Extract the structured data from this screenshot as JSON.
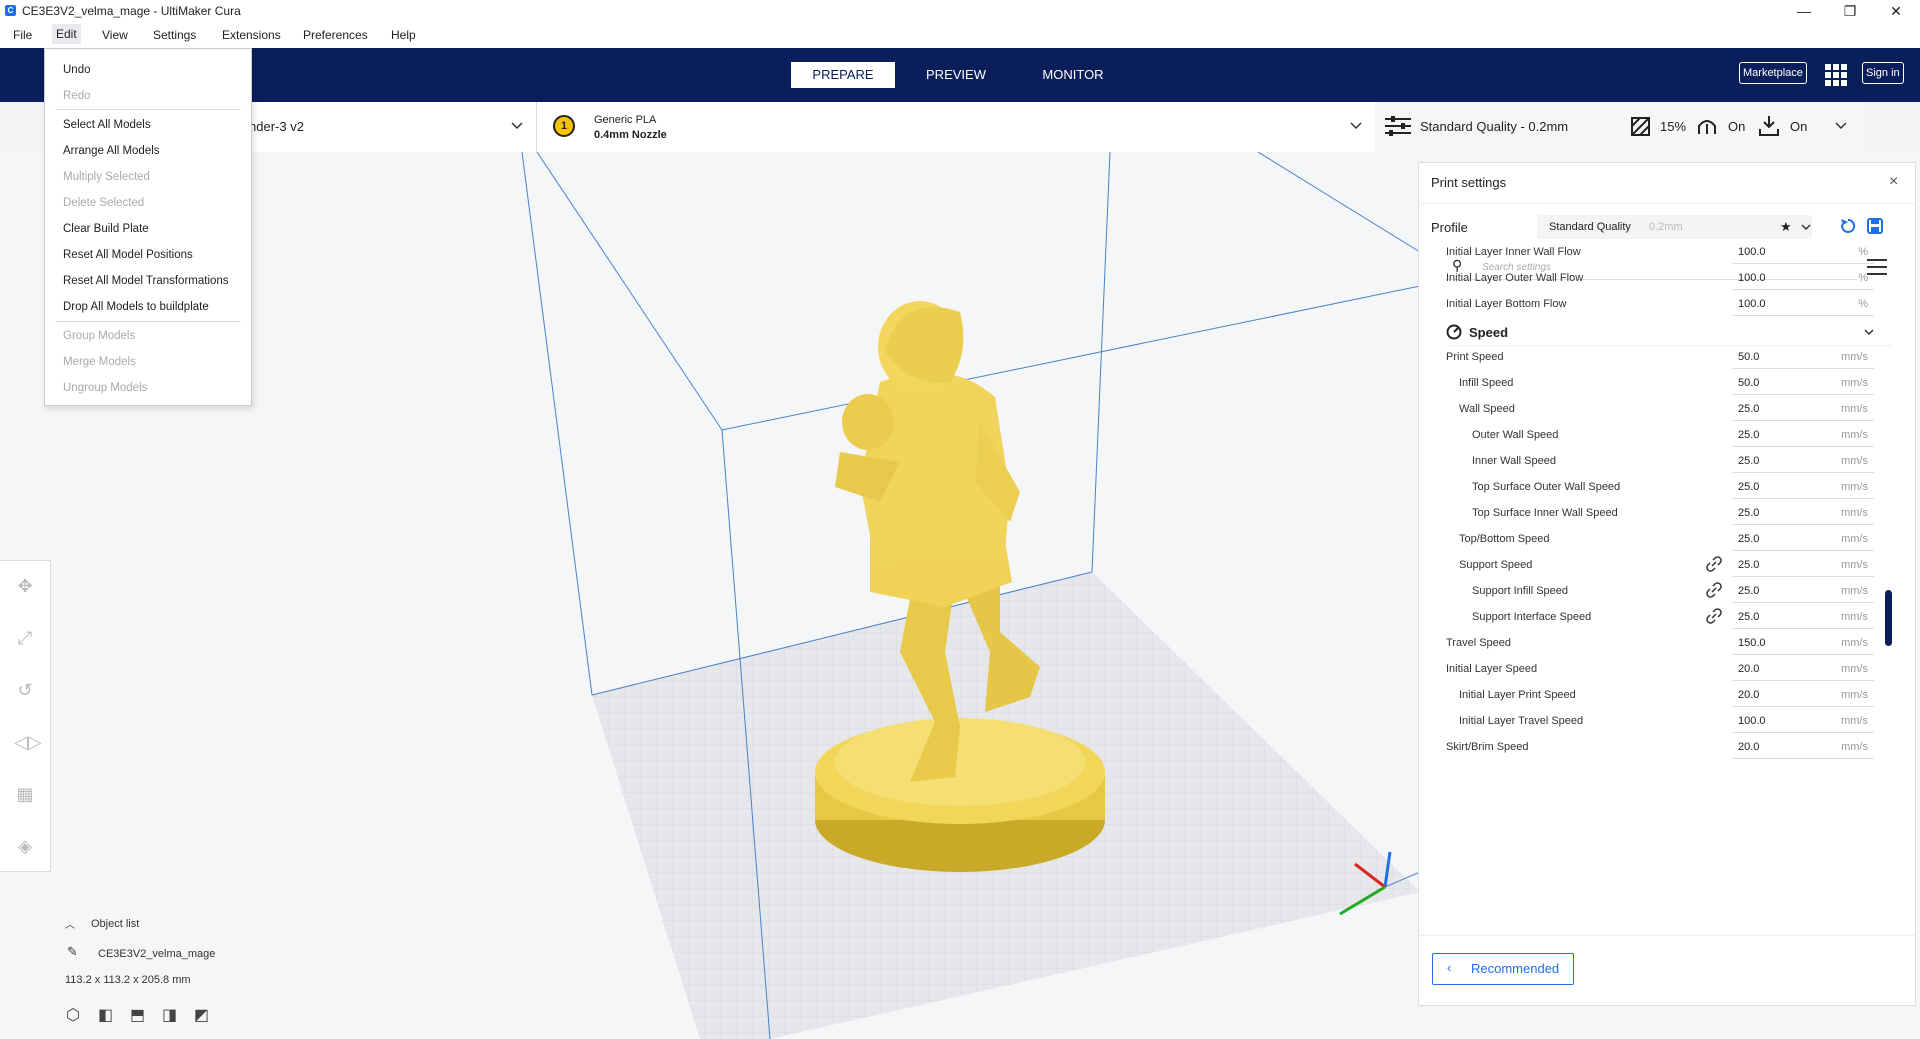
{
  "window": {
    "title": "CE3E3V2_velma_mage - UltiMaker Cura",
    "app_icon": "cura-icon",
    "controls": [
      "minimize-icon",
      "restore-icon",
      "close-icon"
    ]
  },
  "menubar": {
    "items": [
      {
        "label": "File"
      },
      {
        "label": "Edit"
      },
      {
        "label": "View"
      },
      {
        "label": "Settings"
      },
      {
        "label": "Extensions"
      },
      {
        "label": "Preferences"
      },
      {
        "label": "Help"
      }
    ]
  },
  "edit_menu": {
    "items": [
      {
        "label": "Undo",
        "enabled": true
      },
      {
        "label": "Redo",
        "enabled": false
      },
      {
        "label": "Select All Models",
        "enabled": true
      },
      {
        "label": "Arrange All Models",
        "enabled": true
      },
      {
        "label": "Multiply Selected",
        "enabled": false
      },
      {
        "label": "Delete Selected",
        "enabled": false
      },
      {
        "label": "Clear Build Plate",
        "enabled": true
      },
      {
        "label": "Reset All Model Positions",
        "enabled": true
      },
      {
        "label": "Reset All Model Transformations",
        "enabled": true
      },
      {
        "label": "Drop All Models to buildplate",
        "enabled": true
      },
      {
        "label": "Group Models",
        "enabled": false
      },
      {
        "label": "Merge Models",
        "enabled": false
      },
      {
        "label": "Ungroup Models",
        "enabled": false
      }
    ]
  },
  "header": {
    "tabs": [
      {
        "label": "PREPARE",
        "active": true
      },
      {
        "label": "PREVIEW",
        "active": false
      },
      {
        "label": "MONITOR",
        "active": false
      }
    ],
    "marketplace_label": "Marketplace",
    "signin_label": "Sign in"
  },
  "printer_bar": {
    "printer_name_partial": "nder-3 v2",
    "extruder_number": "1",
    "material": "Generic PLA",
    "nozzle": "0.4mm Nozzle",
    "quality": "Standard Quality - 0.2mm",
    "infill": "15%",
    "support": "On",
    "adhesion": "On"
  },
  "print_settings": {
    "title": "Print settings",
    "profile_label": "Profile",
    "profile_value": "Standard Quality",
    "profile_suffix": "0.2mm",
    "search_placeholder": "Search settings",
    "rows_before": [
      {
        "label": "Initial Layer Inner Wall Flow",
        "value": "100.0",
        "unit": "%",
        "indent": 0
      },
      {
        "label": "Initial Layer Outer Wall Flow",
        "value": "100.0",
        "unit": "%",
        "indent": 0
      },
      {
        "label": "Initial Layer Bottom Flow",
        "value": "100.0",
        "unit": "%",
        "indent": 0
      }
    ],
    "category": "Speed",
    "rows": [
      {
        "label": "Print Speed",
        "value": "50.0",
        "unit": "mm/s",
        "indent": 0,
        "link": false
      },
      {
        "label": "Infill Speed",
        "value": "50.0",
        "unit": "mm/s",
        "indent": 1,
        "link": false
      },
      {
        "label": "Wall Speed",
        "value": "25.0",
        "unit": "mm/s",
        "indent": 1,
        "link": false
      },
      {
        "label": "Outer Wall Speed",
        "value": "25.0",
        "unit": "mm/s",
        "indent": 2,
        "link": false
      },
      {
        "label": "Inner Wall Speed",
        "value": "25.0",
        "unit": "mm/s",
        "indent": 2,
        "link": false
      },
      {
        "label": "Top Surface Outer Wall Speed",
        "value": "25.0",
        "unit": "mm/s",
        "indent": 2,
        "link": false
      },
      {
        "label": "Top Surface Inner Wall Speed",
        "value": "25.0",
        "unit": "mm/s",
        "indent": 2,
        "link": false
      },
      {
        "label": "Top/Bottom Speed",
        "value": "25.0",
        "unit": "mm/s",
        "indent": 1,
        "link": false
      },
      {
        "label": "Support Speed",
        "value": "25.0",
        "unit": "mm/s",
        "indent": 1,
        "link": true
      },
      {
        "label": "Support Infill Speed",
        "value": "25.0",
        "unit": "mm/s",
        "indent": 2,
        "link": true
      },
      {
        "label": "Support Interface Speed",
        "value": "25.0",
        "unit": "mm/s",
        "indent": 2,
        "link": true
      },
      {
        "label": "Travel Speed",
        "value": "150.0",
        "unit": "mm/s",
        "indent": 0,
        "link": false
      },
      {
        "label": "Initial Layer Speed",
        "value": "20.0",
        "unit": "mm/s",
        "indent": 0,
        "link": false
      },
      {
        "label": "Initial Layer Print Speed",
        "value": "20.0",
        "unit": "mm/s",
        "indent": 1,
        "link": false
      },
      {
        "label": "Initial Layer Travel Speed",
        "value": "100.0",
        "unit": "mm/s",
        "indent": 1,
        "link": false
      },
      {
        "label": "Skirt/Brim Speed",
        "value": "20.0",
        "unit": "mm/s",
        "indent": 0,
        "link": false
      }
    ],
    "recommended_label": "Recommended"
  },
  "object_list": {
    "header": "Object list",
    "object_name": "CE3E3V2_velma_mage",
    "dimensions": "113.2 x 113.2 x 205.8 mm"
  },
  "colors": {
    "header_bg": "#0b1e5c",
    "accent": "#1f6feb",
    "model": "#f2d65a"
  }
}
